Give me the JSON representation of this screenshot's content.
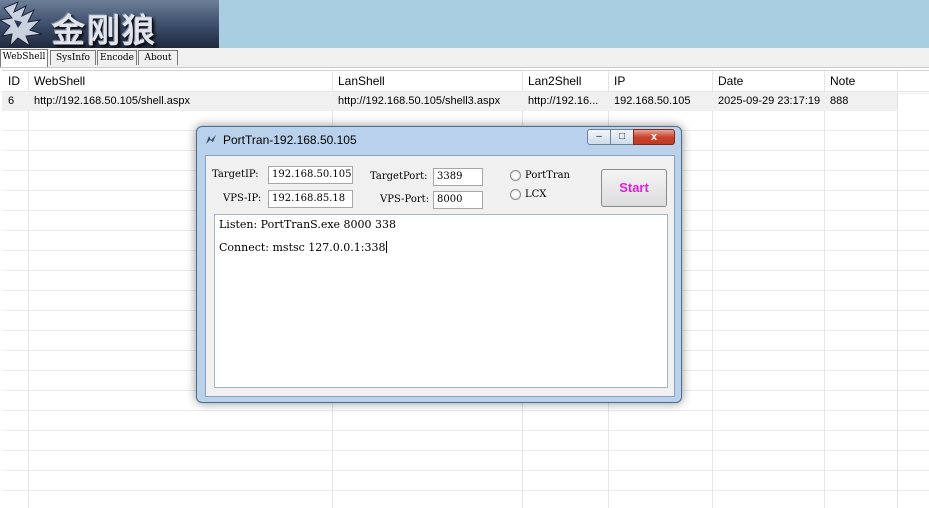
{
  "banner": {
    "logo_text": "金刚狼"
  },
  "tabs": [
    {
      "label": "WebShell"
    },
    {
      "label": "SysInfo"
    },
    {
      "label": "Encode"
    },
    {
      "label": "About"
    }
  ],
  "grid": {
    "columns": [
      "ID",
      "WebShell",
      "LanShell",
      "Lan2Shell",
      "IP",
      "Date",
      "Note"
    ],
    "rows": [
      [
        "6",
        "http://192.168.50.105/shell.aspx",
        "http://192.168.50.105/shell3.aspx",
        "http://192.16...",
        "192.168.50.105",
        "2025-09-29 23:17:19",
        "888"
      ]
    ]
  },
  "dialog": {
    "title": "PortTran-192.168.50.105",
    "controls": {
      "min": "–",
      "max": "□",
      "close": "x"
    },
    "target_ip_label": "TargetIP:",
    "target_ip_value": "192.168.50.105",
    "target_port_label": "TargetPort:",
    "target_port_value": "3389",
    "vps_ip_label": "VPS-IP:",
    "vps_ip_value": "192.168.85.18",
    "vps_port_label": "VPS-Port:",
    "vps_port_value": "8000",
    "radio_porttran": "PortTran",
    "radio_lcx": "LCX",
    "start_label": "Start",
    "output_line1": "Listen: PortTranS.exe 8000 338",
    "output_line2": "Connect: mstsc 127.0.0.1:338"
  },
  "colors": {
    "banner": "#a9cde1",
    "dialog_frame": "#b9d1ea",
    "start_text": "#e020e0",
    "row_selected": "#f0f0f0"
  }
}
